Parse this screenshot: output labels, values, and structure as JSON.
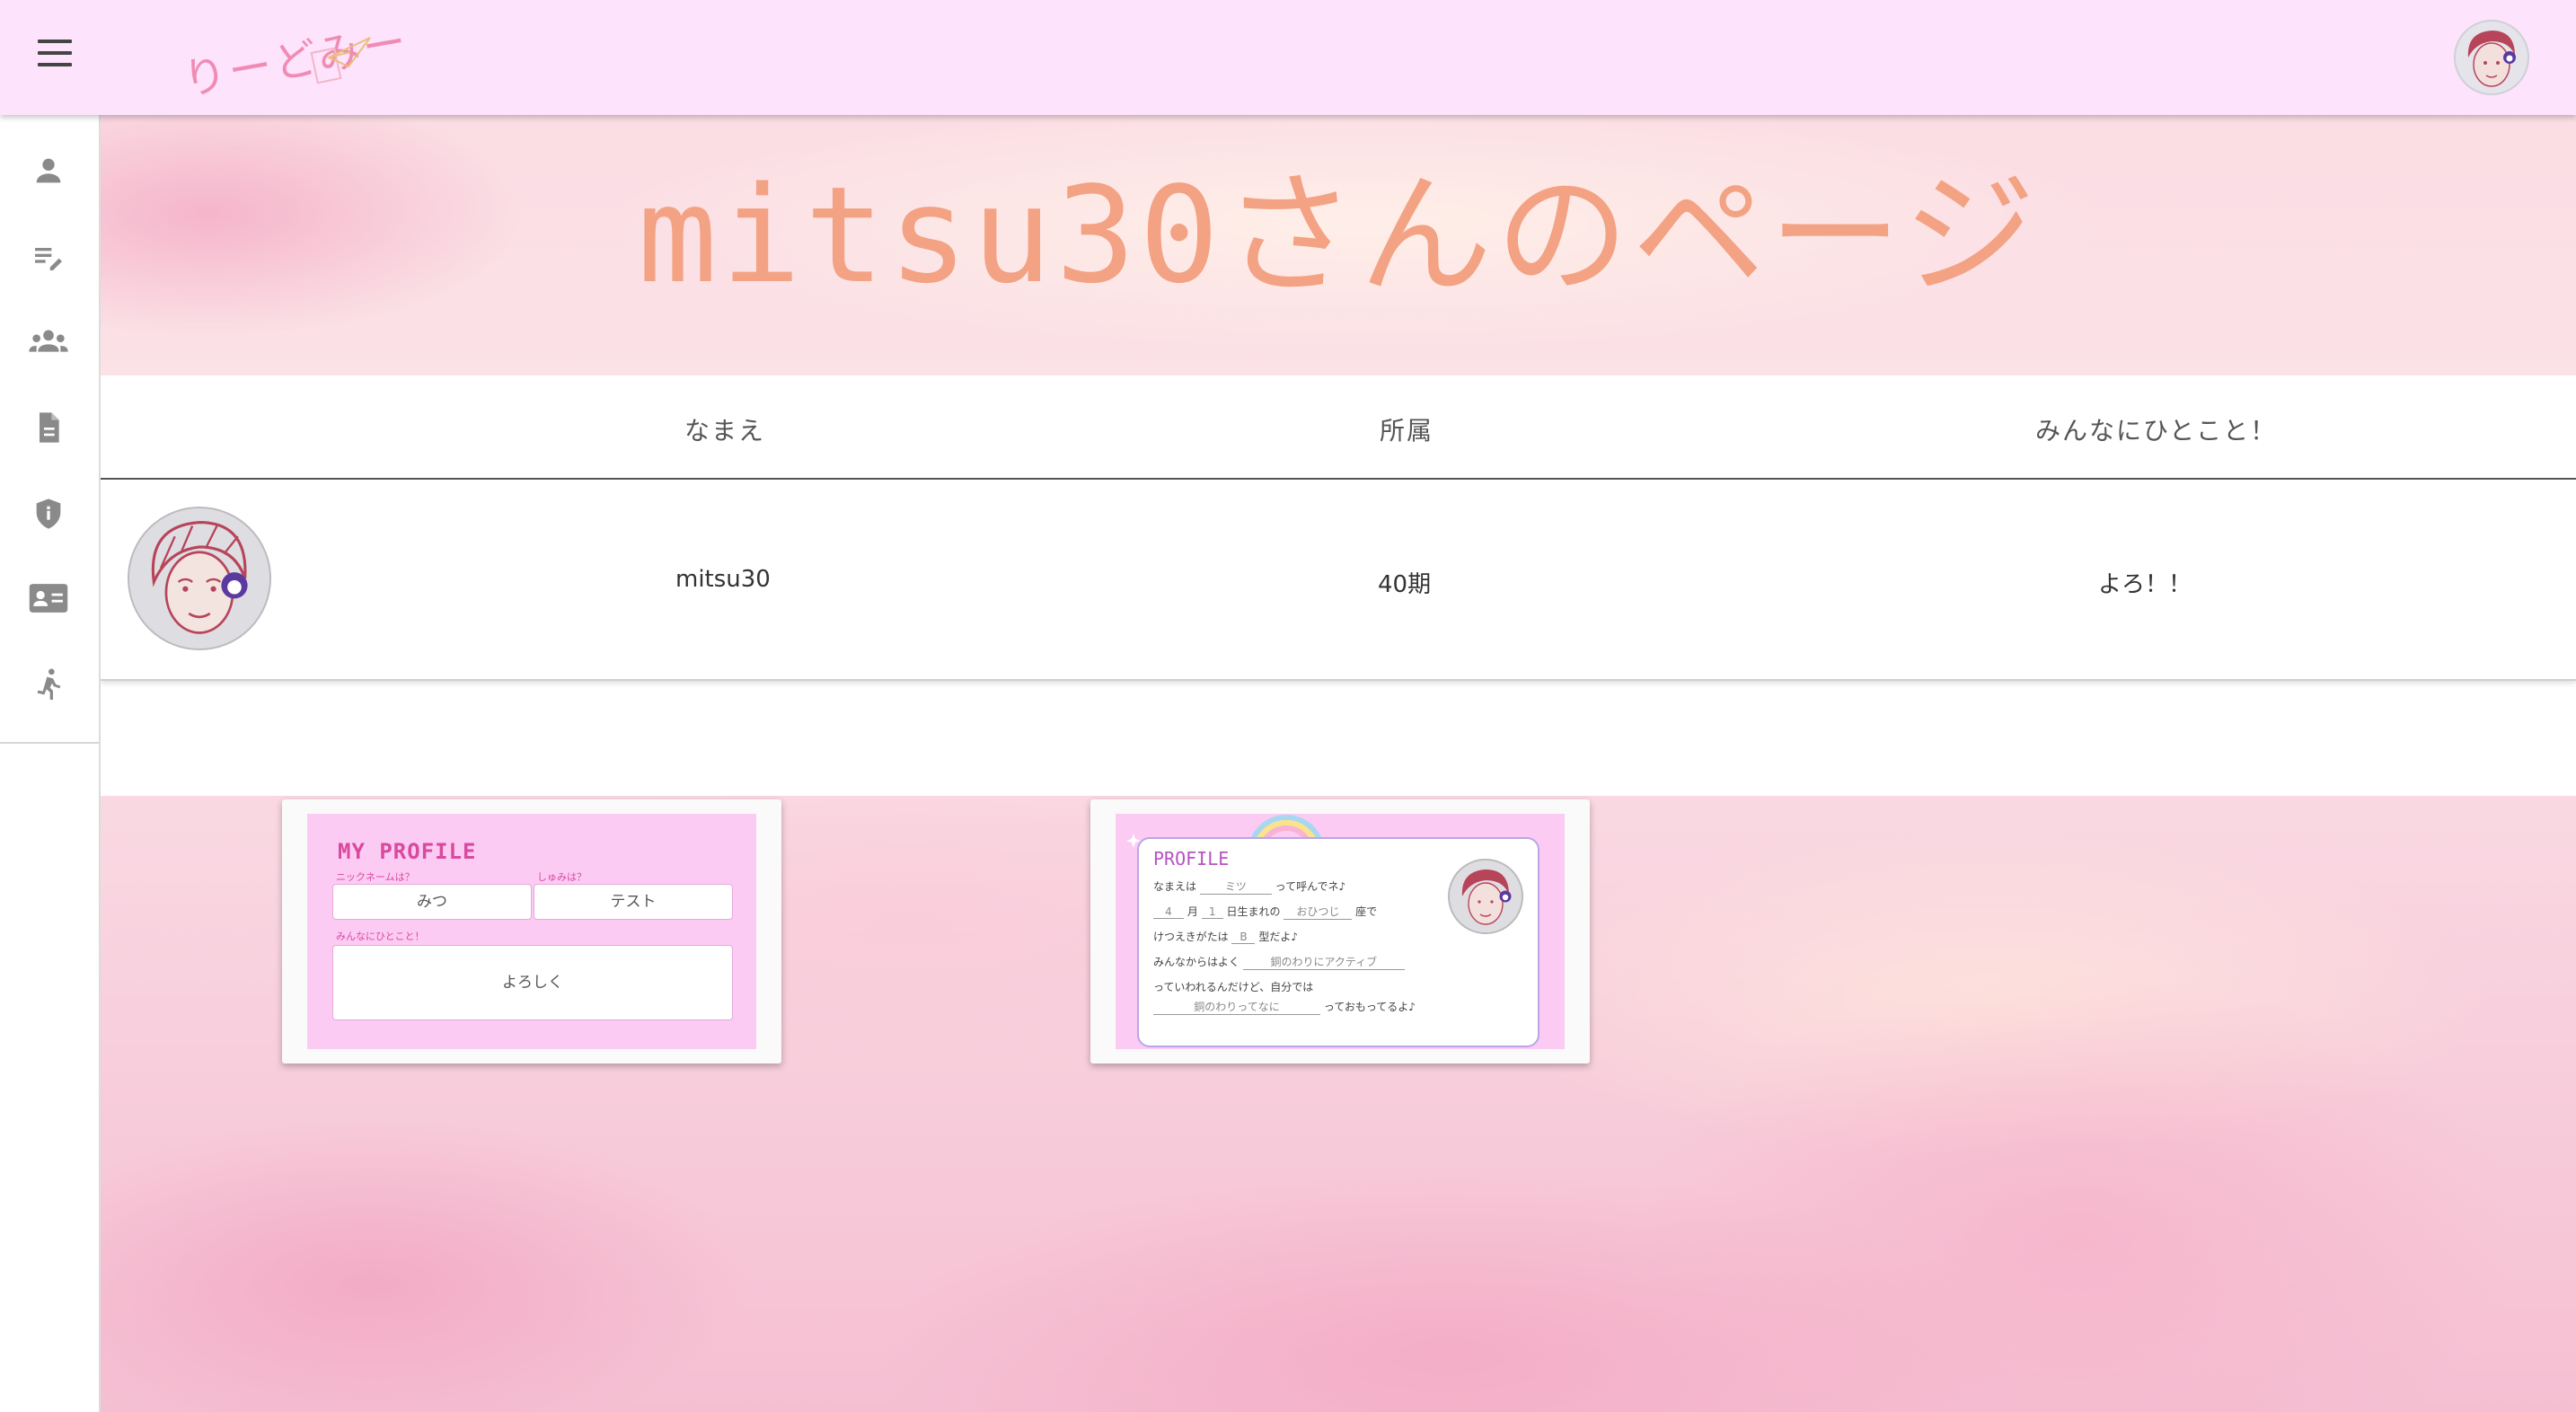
{
  "app": {
    "logo_text": "りーどみー",
    "accent_color": "#fde3fb",
    "title_color": "#f3a283"
  },
  "topbar": {
    "menu_icon": "hamburger-menu-icon",
    "avatar_icon": "user-avatar-icon"
  },
  "sidebar": {
    "items": [
      {
        "icon": "person-icon"
      },
      {
        "icon": "edit-note-icon"
      },
      {
        "icon": "group-icon"
      },
      {
        "icon": "document-icon"
      },
      {
        "icon": "shield-info-icon"
      },
      {
        "icon": "contact-card-icon"
      },
      {
        "icon": "running-person-icon"
      }
    ]
  },
  "page": {
    "title": "mitsu30さんのページ"
  },
  "table": {
    "headers": [
      "なまえ",
      "所属",
      "みんなにひとこと！"
    ],
    "rows": [
      {
        "name": "mitsu30",
        "affiliation": "40期",
        "message": "よろ！！"
      }
    ]
  },
  "card1": {
    "title": "MY PROFILE",
    "nickname_label": "ニックネームは？",
    "hobby_label": "しゅみは？",
    "nickname": "みつ",
    "hobby": "テスト",
    "message_label": "みんなにひとこと！",
    "message": "よろしく"
  },
  "card2": {
    "title": "PROFILE",
    "line1_prefix": "なまえは",
    "line1_value": "ミツ",
    "line1_suffix": "って呼んでネ♪",
    "month": "4",
    "month_label": "月",
    "day": "1",
    "day_label": "日生まれの",
    "zodiac": "おひつじ",
    "zodiac_suffix": "座で",
    "blood_prefix": "けつえきがたは",
    "blood": "B",
    "blood_suffix": "型だよ♪",
    "often_prefix": "みんなからはよく",
    "often_value": "銅のわりにアクティブ",
    "often_suffix": "っていわれるんだけど、自分では",
    "self_value": "銅のわりってなに",
    "self_suffix": "っておもってるよ♪"
  }
}
